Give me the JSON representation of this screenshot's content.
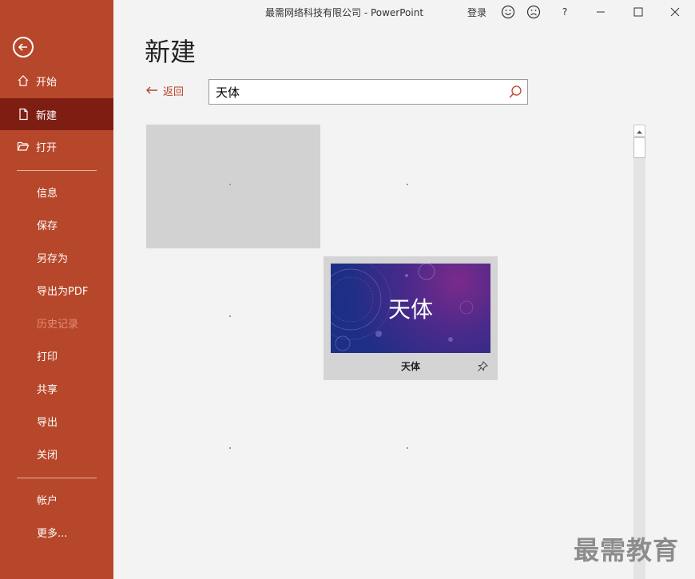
{
  "window": {
    "title": "最需网络科技有限公司  -  PowerPoint",
    "login_label": "登录",
    "help_label": "?"
  },
  "sidebar": {
    "items": [
      {
        "label": "开始",
        "icon": "home-icon"
      },
      {
        "label": "新建",
        "icon": "new-file-icon",
        "active": true
      },
      {
        "label": "打开",
        "icon": "folder-open-icon"
      },
      {
        "label": "信息"
      },
      {
        "label": "保存"
      },
      {
        "label": "另存为"
      },
      {
        "label": "导出为PDF"
      },
      {
        "label": "历史记录",
        "disabled": true
      },
      {
        "label": "打印"
      },
      {
        "label": "共享"
      },
      {
        "label": "导出"
      },
      {
        "label": "关闭"
      },
      {
        "label": "帐户"
      },
      {
        "label": "更多..."
      }
    ]
  },
  "main": {
    "title": "新建",
    "back_label": "返回",
    "search": {
      "value": "天体"
    },
    "template": {
      "thumb_text": "天体",
      "label": "天体"
    }
  },
  "watermark": "最需教育",
  "colors": {
    "accent": "#b7472a",
    "active": "#7e1e12"
  }
}
